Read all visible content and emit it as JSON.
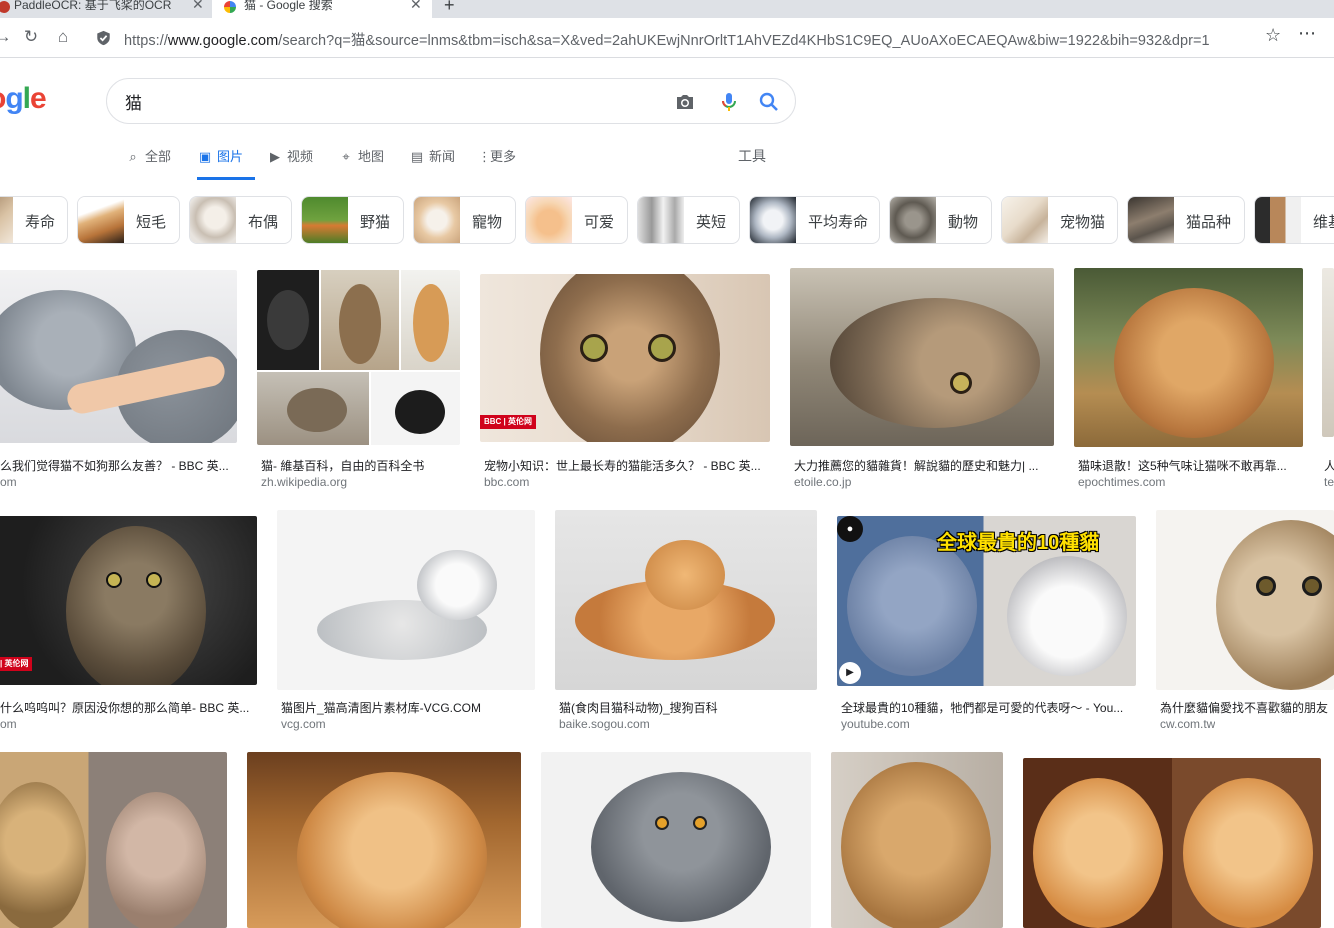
{
  "browser": {
    "tabs": [
      {
        "title": "PaddleOCR: 基于飞桨的OCR",
        "active": false
      },
      {
        "title": "猫 - Google 搜索",
        "active": true
      }
    ],
    "new_tab_label": "+",
    "url_prefix": "https://",
    "url_host": "www.google.com",
    "url_path": "/search?q=猫&source=lnms&tbm=isch&sa=X&ved=2ahUKEwjNnrOrltT1AhVEZd4KHbS1C9EQ_AUoAXoECAEQAw&biw=1922&bih=932&dpr=1"
  },
  "google": {
    "logo_letters": [
      "o",
      "g",
      "l",
      "e"
    ],
    "logo_colors": [
      "#ea4335",
      "#4285f4",
      "#34a853",
      "#ea4335"
    ],
    "query": "猫"
  },
  "nav": {
    "tabs": [
      {
        "label": "全部",
        "icon": "search-icon",
        "active": false
      },
      {
        "label": "图片",
        "icon": "image-icon",
        "active": true
      },
      {
        "label": "视频",
        "icon": "video-icon",
        "active": false
      },
      {
        "label": "地图",
        "icon": "map-pin-icon",
        "active": false
      },
      {
        "label": "新闻",
        "icon": "news-icon",
        "active": false
      },
      {
        "label": "更多",
        "icon": "more-vert-icon",
        "active": false
      }
    ],
    "tools_label": "工具"
  },
  "chips": [
    {
      "label": "寿命"
    },
    {
      "label": "短毛"
    },
    {
      "label": "布偶"
    },
    {
      "label": "野猫"
    },
    {
      "label": "寵物"
    },
    {
      "label": "可爱"
    },
    {
      "label": "英短"
    },
    {
      "label": "平均寿命"
    },
    {
      "label": "動物"
    },
    {
      "label": "宠物猫"
    },
    {
      "label": "猫品种"
    },
    {
      "label": "维基"
    }
  ],
  "results": [
    {
      "caption": "么我们觉得猫不如狗那么友善？ - BBC 英...",
      "source": "om"
    },
    {
      "caption": "猫- 維基百科，自由的百科全书",
      "source": "zh.wikipedia.org"
    },
    {
      "caption": "宠物小知识：世上最长寿的猫能活多久？ - BBC 英...",
      "source": "bbc.com"
    },
    {
      "caption": "大力推薦您的貓雜貨！解說貓的歷史和魅力| ...",
      "source": "etoile.co.jp"
    },
    {
      "caption": "猫味退散！这5种气味让猫咪不敢再靠...",
      "source": "epochtimes.com"
    },
    {
      "caption": "人",
      "source": "te"
    },
    {
      "caption": "什么呜呜叫？原因没你想的那么简单- BBC 英...",
      "source": "om"
    },
    {
      "caption": "猫图片_猫高清图片素材库-VCG.COM",
      "source": "vcg.com"
    },
    {
      "caption": "猫(食肉目猫科动物)_搜狗百科",
      "source": "baike.sogou.com"
    },
    {
      "caption": "全球最貴的10種貓，牠們都是可愛的代表呀～ - You...",
      "source": "youtube.com"
    },
    {
      "caption": "為什麼貓偏愛找不喜歡貓的朋友",
      "source": "cw.com.tw"
    }
  ],
  "overlays": {
    "bbc_badge_1": "BBC | 英伦网",
    "bbc_badge_2": "| 英伦网",
    "yt_title": "全球最貴的10種貓",
    "play": "▶"
  },
  "colors": {
    "accent": "#1a73e8",
    "caption": "#202124",
    "source": "#70757a",
    "bbc_red": "#d0021b"
  }
}
